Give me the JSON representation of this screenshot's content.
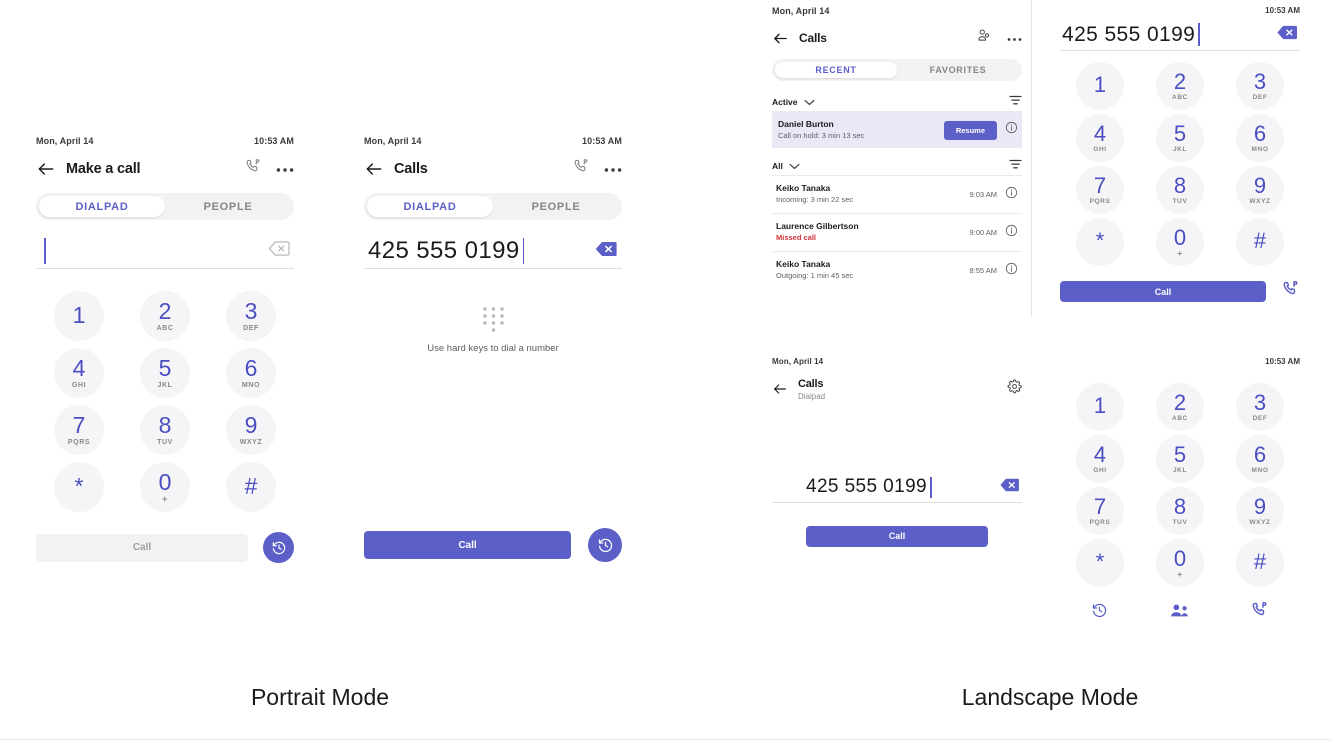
{
  "captions": {
    "portrait": "Portrait Mode",
    "landscape": "Landscape Mode"
  },
  "colors": {
    "accent": "#5b5fc7",
    "key_digit": "#4a4ec0",
    "missed": "#d13438",
    "key_bg": "#f5f5f7",
    "active_row_bg": "#e9e8f7"
  },
  "status": {
    "date": "Mon, April 14",
    "time": "10:53 AM"
  },
  "keypad": [
    {
      "digit": "1",
      "letters": ""
    },
    {
      "digit": "2",
      "letters": "ABC"
    },
    {
      "digit": "3",
      "letters": "DEF"
    },
    {
      "digit": "4",
      "letters": "GHI"
    },
    {
      "digit": "5",
      "letters": "JKL"
    },
    {
      "digit": "6",
      "letters": "MNO"
    },
    {
      "digit": "7",
      "letters": "PQRS"
    },
    {
      "digit": "8",
      "letters": "TUV"
    },
    {
      "digit": "9",
      "letters": "WXYZ"
    },
    {
      "digit": "*",
      "letters": ""
    },
    {
      "digit": "0",
      "letters": "+"
    },
    {
      "digit": "#",
      "letters": ""
    }
  ],
  "panel1": {
    "status": {
      "date": "Mon, April 14",
      "time": "10:53 AM"
    },
    "title": "Make a call",
    "icons": {
      "back": "back-arrow-icon",
      "park": "phone-park-icon",
      "more": "more-options-icon"
    },
    "tabs": [
      {
        "label": "DIALPAD",
        "selected": true
      },
      {
        "label": "PEOPLE",
        "selected": false
      }
    ],
    "number": "",
    "backspace_icon": "backspace-outline-icon",
    "call_label": "Call",
    "call_enabled": false,
    "history_icon": "call-history-icon"
  },
  "panel2": {
    "status": {
      "date": "Mon, April 14",
      "time": "10:53 AM"
    },
    "title": "Calls",
    "icons": {
      "back": "back-arrow-icon",
      "park": "phone-park-icon",
      "more": "more-options-icon"
    },
    "tabs": [
      {
        "label": "DIALPAD",
        "selected": true
      },
      {
        "label": "PEOPLE",
        "selected": false
      }
    ],
    "number": "425 555 0199",
    "backspace_icon": "backspace-filled-icon",
    "hint": "Use hard keys to dial a number",
    "keypad_placeholder_icon": "dialpad-dots-icon",
    "call_label": "Call",
    "call_enabled": true,
    "history_icon": "call-history-icon"
  },
  "panel3": {
    "status": {
      "date": "Mon, April 14",
      "time": "10:53 AM"
    },
    "title": "Calls",
    "icons": {
      "back": "back-arrow-icon",
      "people": "add-contact-icon",
      "more": "more-options-icon",
      "filter": "filter-icon",
      "info": "info-icon"
    },
    "tabs": [
      {
        "label": "RECENT",
        "selected": true
      },
      {
        "label": "FAVORITES",
        "selected": false
      }
    ],
    "sections": [
      {
        "label": "Active",
        "items": [
          {
            "name": "Daniel Burton",
            "sub": "Call on hold: 3 min 13 sec",
            "sub_type": "normal",
            "time": "",
            "action": "Resume",
            "active": true
          }
        ]
      },
      {
        "label": "All",
        "items": [
          {
            "name": "Keiko Tanaka",
            "sub": "Incoming: 3 min 22 sec",
            "sub_type": "normal",
            "time": "9:03 AM",
            "action": "",
            "active": false
          },
          {
            "name": "Laurence Gilbertson",
            "sub": "Missed call",
            "sub_type": "missed",
            "time": "9:00 AM",
            "action": "",
            "active": false
          },
          {
            "name": "Keiko Tanaka",
            "sub": "Outgoing: 1 min 45 sec",
            "sub_type": "normal",
            "time": "8:55 AM",
            "action": "",
            "active": false
          }
        ]
      }
    ],
    "dial": {
      "time": "10:53 AM",
      "number": "425 555 0199",
      "backspace_icon": "backspace-filled-icon",
      "call_label": "Call",
      "park_icon": "phone-park-icon"
    }
  },
  "panel4": {
    "status": {
      "date": "Mon, April 14",
      "time": "10:53 AM"
    },
    "title": "Calls",
    "subtitle": "Dialpad",
    "icons": {
      "back": "back-arrow-icon",
      "settings": "settings-gear-icon"
    },
    "number": "425 555 0199",
    "backspace_icon": "backspace-filled-icon",
    "call_label": "Call",
    "bottom_icons": [
      "call-history-icon",
      "people-icon",
      "phone-park-icon"
    ]
  }
}
